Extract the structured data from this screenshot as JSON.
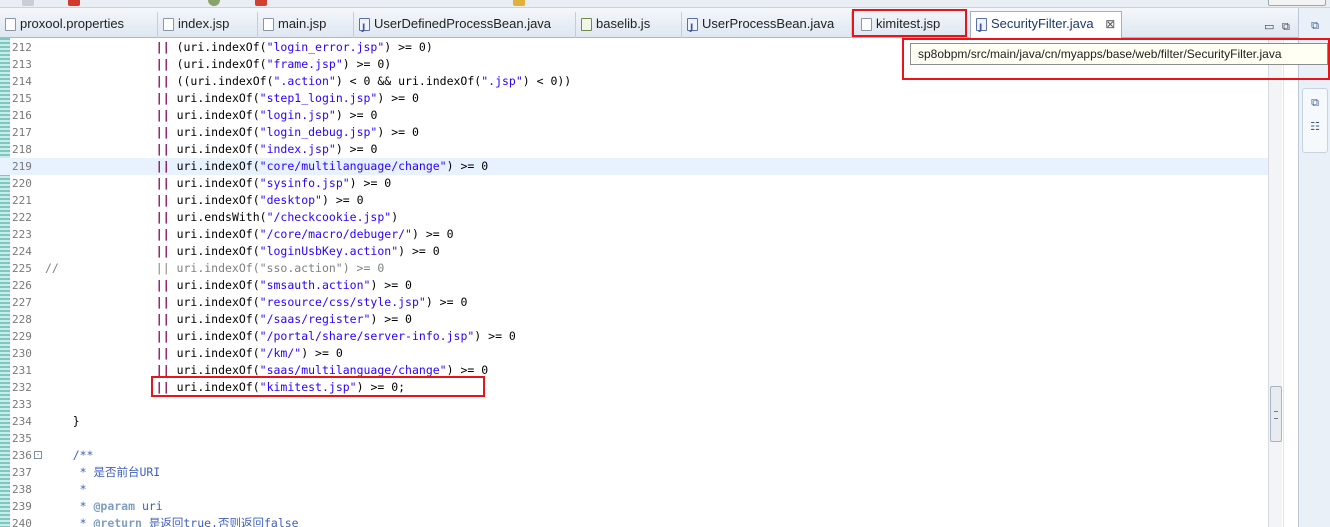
{
  "tabs": [
    {
      "label": "proxool.properties",
      "icon": "file-icon"
    },
    {
      "label": "index.jsp",
      "icon": "file-icon"
    },
    {
      "label": "main.jsp",
      "icon": "file-icon"
    },
    {
      "label": "UserDefinedProcessBean.java",
      "icon": "java-file-icon"
    },
    {
      "label": "baselib.js",
      "icon": "js-file-icon"
    },
    {
      "label": "UserProcessBean.java",
      "icon": "java-file-icon"
    },
    {
      "label": "kimitest.jsp",
      "icon": "file-icon"
    },
    {
      "label": "SecurityFilter.java",
      "icon": "java-file-icon",
      "close": "⊠"
    }
  ],
  "tab_menu": {
    "minimize": "▭",
    "maximize": "⧉"
  },
  "tooltip": {
    "text": "sp8obpm/src/main/java/cn/myapps/base/web/filter/SecurityFilter.java"
  },
  "highlight_color": "#e8141a",
  "current_line_color": "#e8f2fe",
  "editor": {
    "lines": [
      {
        "num": "212",
        "indent": "                ",
        "op": "||",
        "rest": [
          [
            "p",
            " (uri.indexOf("
          ],
          [
            "s",
            "\"login_error.jsp\""
          ],
          [
            "p",
            ") >= 0)"
          ]
        ]
      },
      {
        "num": "213",
        "indent": "                ",
        "op": "||",
        "rest": [
          [
            "p",
            " (uri.indexOf("
          ],
          [
            "s",
            "\"frame.jsp\""
          ],
          [
            "p",
            ") >= 0)"
          ]
        ]
      },
      {
        "num": "214",
        "indent": "                ",
        "op": "||",
        "rest": [
          [
            "p",
            " ((uri.indexOf("
          ],
          [
            "s",
            "\".action\""
          ],
          [
            "p",
            ") < 0 && uri.indexOf("
          ],
          [
            "s",
            "\".jsp\""
          ],
          [
            "p",
            ") < 0))"
          ]
        ]
      },
      {
        "num": "215",
        "indent": "                ",
        "op": "||",
        "rest": [
          [
            "p",
            " uri.indexOf("
          ],
          [
            "s",
            "\"step1_login.jsp\""
          ],
          [
            "p",
            ") >= 0"
          ]
        ]
      },
      {
        "num": "216",
        "indent": "                ",
        "op": "||",
        "rest": [
          [
            "p",
            " uri.indexOf("
          ],
          [
            "s",
            "\"login.jsp\""
          ],
          [
            "p",
            ") >= 0"
          ]
        ]
      },
      {
        "num": "217",
        "indent": "                ",
        "op": "||",
        "rest": [
          [
            "p",
            " uri.indexOf("
          ],
          [
            "s",
            "\"login_debug.jsp\""
          ],
          [
            "p",
            ") >= 0"
          ]
        ]
      },
      {
        "num": "218",
        "indent": "                ",
        "op": "||",
        "rest": [
          [
            "p",
            " uri.indexOf("
          ],
          [
            "s",
            "\"index.jsp\""
          ],
          [
            "p",
            ") >= 0"
          ]
        ]
      },
      {
        "num": "219",
        "indent": "                ",
        "op": "||",
        "rest": [
          [
            "p",
            " uri.indexOf("
          ],
          [
            "s",
            "\"core/multilanguage/change\""
          ],
          [
            "p",
            ") >= 0"
          ]
        ],
        "current": true
      },
      {
        "num": "220",
        "indent": "                ",
        "op": "||",
        "rest": [
          [
            "p",
            " uri.indexOf("
          ],
          [
            "s",
            "\"sysinfo.jsp\""
          ],
          [
            "p",
            ") >= 0"
          ]
        ]
      },
      {
        "num": "221",
        "indent": "                ",
        "op": "||",
        "rest": [
          [
            "p",
            " uri.indexOf("
          ],
          [
            "s",
            "\"desktop\""
          ],
          [
            "p",
            ") >= 0"
          ]
        ]
      },
      {
        "num": "222",
        "indent": "                ",
        "op": "||",
        "rest": [
          [
            "p",
            " uri.endsWith("
          ],
          [
            "s",
            "\"/checkcookie.jsp\""
          ],
          [
            "p",
            ")"
          ]
        ]
      },
      {
        "num": "223",
        "indent": "                ",
        "op": "||",
        "rest": [
          [
            "p",
            " uri.indexOf("
          ],
          [
            "s",
            "\"/core/macro/debuger/\""
          ],
          [
            "p",
            ") >= 0"
          ]
        ]
      },
      {
        "num": "224",
        "indent": "                ",
        "op": "||",
        "rest": [
          [
            "p",
            " uri.indexOf("
          ],
          [
            "s",
            "\"loginUsbKey.action\""
          ],
          [
            "p",
            ") >= 0"
          ]
        ]
      },
      {
        "num": "225",
        "comment": "//              || uri.indexOf(\"sso.action\") >= 0"
      },
      {
        "num": "226",
        "indent": "                ",
        "op": "||",
        "rest": [
          [
            "p",
            " uri.indexOf("
          ],
          [
            "s",
            "\"smsauth.action\""
          ],
          [
            "p",
            ") >= 0"
          ]
        ]
      },
      {
        "num": "227",
        "indent": "                ",
        "op": "||",
        "rest": [
          [
            "p",
            " uri.indexOf("
          ],
          [
            "s",
            "\"resource/css/style.jsp\""
          ],
          [
            "p",
            ") >= 0"
          ]
        ]
      },
      {
        "num": "228",
        "indent": "                ",
        "op": "||",
        "rest": [
          [
            "p",
            " uri.indexOf("
          ],
          [
            "s",
            "\"/saas/register\""
          ],
          [
            "p",
            ") >= 0"
          ]
        ]
      },
      {
        "num": "229",
        "indent": "                ",
        "op": "||",
        "rest": [
          [
            "p",
            " uri.indexOf("
          ],
          [
            "s",
            "\"/portal/share/server-info.jsp\""
          ],
          [
            "p",
            ") >= 0"
          ]
        ]
      },
      {
        "num": "230",
        "indent": "                ",
        "op": "||",
        "rest": [
          [
            "p",
            " uri.indexOf("
          ],
          [
            "s",
            "\"/km/\""
          ],
          [
            "p",
            ") >= 0"
          ]
        ]
      },
      {
        "num": "231",
        "indent": "                ",
        "op": "||",
        "rest": [
          [
            "p",
            " uri.indexOf("
          ],
          [
            "s",
            "\"saas/multilanguage/change\""
          ],
          [
            "p",
            ") >= 0"
          ]
        ]
      },
      {
        "num": "232",
        "indent": "                ",
        "op": "||",
        "rest": [
          [
            "p",
            " uri.indexOf("
          ],
          [
            "s",
            "\"kimitest.jsp\""
          ],
          [
            "p",
            ") >= 0;"
          ]
        ]
      },
      {
        "num": "233",
        "plain": ""
      },
      {
        "num": "234",
        "plain": "    }"
      },
      {
        "num": "235",
        "plain": ""
      },
      {
        "num": "236",
        "jd": "    /**",
        "fold": "⊖"
      },
      {
        "num": "237",
        "jd": "     * 是否前台URI"
      },
      {
        "num": "238",
        "jd": "     *"
      },
      {
        "num": "239",
        "jd": "     * ",
        "tag": "@param",
        "jdrest": " uri"
      },
      {
        "num": "240",
        "jd": "     * ",
        "tag": "@return",
        "jdrest": " 是返回true,否则返回false"
      }
    ]
  }
}
